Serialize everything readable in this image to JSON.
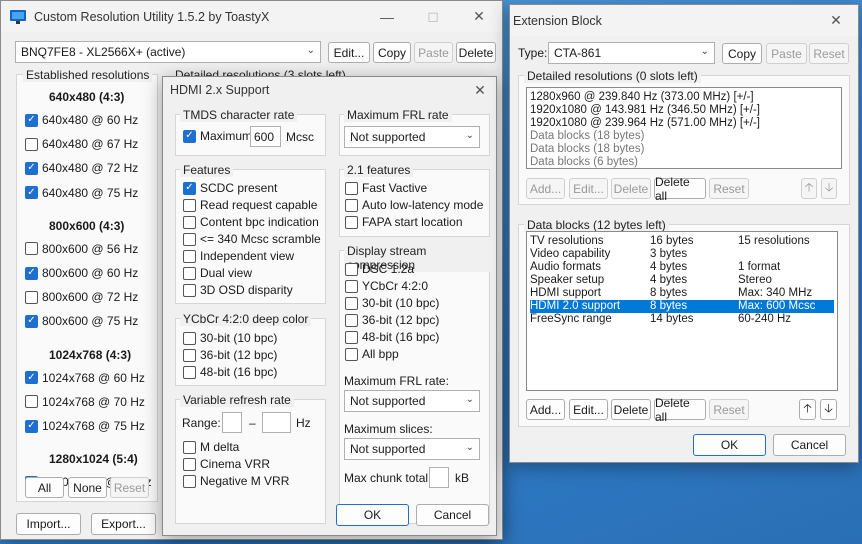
{
  "main": {
    "title": "Custom Resolution Utility 1.5.2 by ToastyX",
    "monitor": "BNQ7FE8 - XL2566X+ (active)",
    "buttons": {
      "edit": "Edit...",
      "copy": "Copy",
      "paste": "Paste",
      "delete": "Delete",
      "all": "All",
      "none": "None",
      "reset": "Reset",
      "import": "Import...",
      "export": "Export..."
    },
    "established_title": "Established resolutions",
    "detailed_title": "Detailed resolutions (3 slots left)",
    "groups": [
      {
        "header": "640x480 (4:3)",
        "items": [
          {
            "label": "640x480 @ 60 Hz",
            "checked": true
          },
          {
            "label": "640x480 @ 67 Hz",
            "checked": false
          },
          {
            "label": "640x480 @ 72 Hz",
            "checked": true
          },
          {
            "label": "640x480 @ 75 Hz",
            "checked": true
          }
        ]
      },
      {
        "header": "800x600 (4:3)",
        "items": [
          {
            "label": "800x600 @ 56 Hz",
            "checked": false
          },
          {
            "label": "800x600 @ 60 Hz",
            "checked": true
          },
          {
            "label": "800x600 @ 72 Hz",
            "checked": false
          },
          {
            "label": "800x600 @ 75 Hz",
            "checked": true
          }
        ]
      },
      {
        "header": "1024x768 (4:3)",
        "items": [
          {
            "label": "1024x768 @ 60 Hz",
            "checked": true
          },
          {
            "label": "1024x768 @ 70 Hz",
            "checked": false
          },
          {
            "label": "1024x768 @ 75 Hz",
            "checked": true
          }
        ]
      },
      {
        "header": "1280x1024 (5:4)",
        "items": [
          {
            "label": "1280x1024 @ 75 Hz",
            "checked": true
          }
        ]
      }
    ]
  },
  "hdmi": {
    "title": "HDMI 2.x Support",
    "tmds_title": "TMDS character rate",
    "max_label": "Maximum:",
    "max_value": "600",
    "max_unit": "Mcsc",
    "features_title": "Features",
    "features": [
      {
        "label": "SCDC present",
        "checked": true
      },
      {
        "label": "Read request capable",
        "checked": false
      },
      {
        "label": "Content bpc indication",
        "checked": false
      },
      {
        "label": "<= 340 Mcsc scramble",
        "checked": false
      },
      {
        "label": "Independent view",
        "checked": false
      },
      {
        "label": "Dual view",
        "checked": false
      },
      {
        "label": "3D OSD disparity",
        "checked": false
      }
    ],
    "ycbcr_title": "YCbCr 4:2:0 deep color",
    "ycbcr": [
      {
        "label": "30-bit (10 bpc)",
        "checked": false
      },
      {
        "label": "36-bit (12 bpc)",
        "checked": false
      },
      {
        "label": "48-bit (16 bpc)",
        "checked": false
      }
    ],
    "vrr_title": "Variable refresh rate",
    "range_label": "Range:",
    "range_sep": "–",
    "range_unit": "Hz",
    "vrr": [
      {
        "label": "M delta",
        "checked": false
      },
      {
        "label": "Cinema VRR",
        "checked": false
      },
      {
        "label": "Negative M VRR",
        "checked": false
      }
    ],
    "frl_title": "Maximum FRL rate",
    "frl_value": "Not supported",
    "f21_title": "2.1 features",
    "f21": [
      {
        "label": "Fast Vactive",
        "checked": false
      },
      {
        "label": "Auto low-latency mode",
        "checked": false
      },
      {
        "label": "FAPA start location",
        "checked": false
      }
    ],
    "dsc_title": "Display stream compression",
    "dsc": [
      {
        "label": "DSC 1.2a",
        "checked": false
      },
      {
        "label": "YCbCr 4:2:0",
        "checked": false
      },
      {
        "label": "30-bit (10 bpc)",
        "checked": false
      },
      {
        "label": "36-bit (12 bpc)",
        "checked": false
      },
      {
        "label": "48-bit (16 bpc)",
        "checked": false
      },
      {
        "label": "All bpp",
        "checked": false
      }
    ],
    "dsc_frl_label": "Maximum FRL rate:",
    "dsc_frl_value": "Not supported",
    "slices_label": "Maximum slices:",
    "slices_value": "Not supported",
    "chunk_label": "Max chunk total:",
    "chunk_unit": "kB",
    "ok": "OK",
    "cancel": "Cancel"
  },
  "ext": {
    "title": "Extension Block",
    "type_label": "Type:",
    "type_value": "CTA-861",
    "buttons": {
      "copy": "Copy",
      "paste": "Paste",
      "reset": "Reset",
      "add": "Add...",
      "edit": "Edit...",
      "delete": "Delete",
      "delete_all": "Delete all",
      "ok": "OK",
      "cancel": "Cancel"
    },
    "detailed_title": "Detailed resolutions (0 slots left)",
    "detailed": [
      {
        "text": "1280x960 @ 239.840 Hz (373.00 MHz) [+/-]",
        "gray": false
      },
      {
        "text": "1920x1080 @ 143.981 Hz (346.50 MHz) [+/-]",
        "gray": false
      },
      {
        "text": "1920x1080 @ 239.964 Hz (571.00 MHz) [+/-]",
        "gray": false
      },
      {
        "text": "Data blocks (18 bytes)",
        "gray": true
      },
      {
        "text": "Data blocks (18 bytes)",
        "gray": true
      },
      {
        "text": "Data blocks (6 bytes)",
        "gray": true
      }
    ],
    "datablocks_title": "Data blocks (12 bytes left)",
    "datablocks": [
      {
        "name": "TV resolutions",
        "size": "16 bytes",
        "info": "15 resolutions"
      },
      {
        "name": "Video capability",
        "size": "3 bytes",
        "info": ""
      },
      {
        "name": "Audio formats",
        "size": "4 bytes",
        "info": "1 format"
      },
      {
        "name": "Speaker setup",
        "size": "4 bytes",
        "info": "Stereo"
      },
      {
        "name": "HDMI support",
        "size": "8 bytes",
        "info": "Max: 340 MHz"
      },
      {
        "name": "HDMI 2.0 support",
        "size": "8 bytes",
        "info": "Max: 600 Mcsc",
        "selected": true
      },
      {
        "name": "FreeSync range",
        "size": "14 bytes",
        "info": "60-240 Hz"
      }
    ]
  },
  "colors": {
    "accent": "#0078d7",
    "desktop": "#3e8ed6"
  }
}
